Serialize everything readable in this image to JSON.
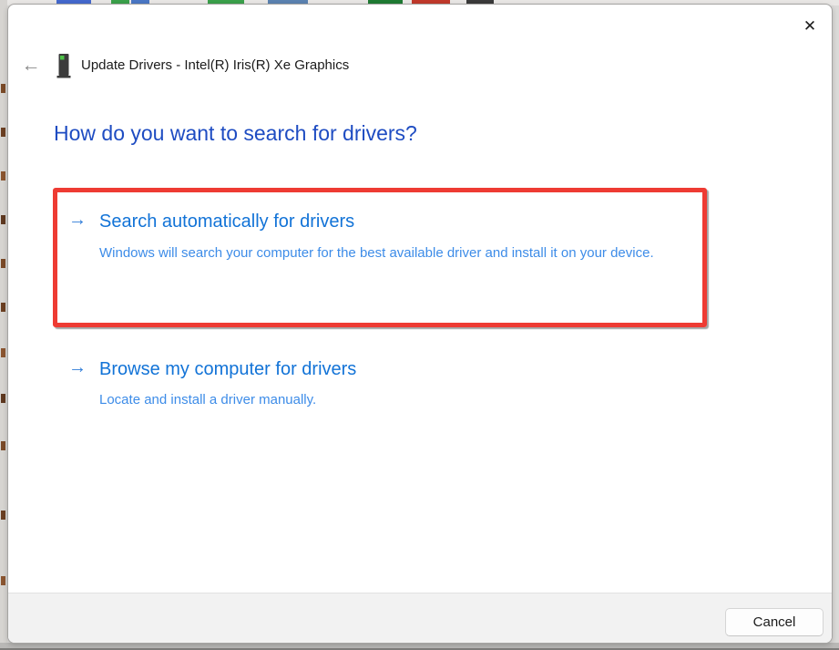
{
  "window": {
    "title": "Update Drivers - Intel(R) Iris(R) Xe Graphics"
  },
  "heading": "How do you want to search for drivers?",
  "options": [
    {
      "title": "Search automatically for drivers",
      "description": "Windows will search your computer for the best available driver and install it on your device.",
      "highlighted": true
    },
    {
      "title": "Browse my computer for drivers",
      "description": "Locate and install a driver manually.",
      "highlighted": false
    }
  ],
  "footer": {
    "cancel_label": "Cancel"
  },
  "icons": {
    "back": "←",
    "close": "✕",
    "option_arrow": "→",
    "device": "display-adapter-icon"
  },
  "colors": {
    "heading_blue": "#1e4cc2",
    "link_blue": "#1273d7",
    "description_blue": "#3d8ce8",
    "arrow_blue": "#2e7cd8",
    "annotation_red": "#ee3b33",
    "footer_gray": "#f2f2f2"
  },
  "annotation": {
    "shape": "rectangle",
    "color": "#ee3b33"
  }
}
